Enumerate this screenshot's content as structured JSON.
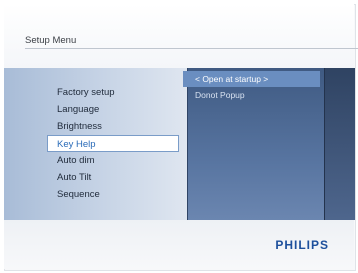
{
  "header": {
    "title": "Setup Menu"
  },
  "menu": {
    "items": [
      {
        "label": "Factory setup"
      },
      {
        "label": "Language"
      },
      {
        "label": "Brightness"
      },
      {
        "label": "Key Help"
      },
      {
        "label": "Auto dim"
      },
      {
        "label": "Auto Tilt"
      },
      {
        "label": "Sequence"
      }
    ],
    "selected_index": 3
  },
  "submenu": {
    "items": [
      {
        "label": "< Open at startup >"
      },
      {
        "label": "Donot Popup"
      }
    ],
    "active_index": 0
  },
  "footer": {
    "logo": "PHILIPS"
  },
  "colors": {
    "accent": "#2a6bb8",
    "panel_mid": "#5774a0",
    "logo": "#1d4f9c"
  }
}
